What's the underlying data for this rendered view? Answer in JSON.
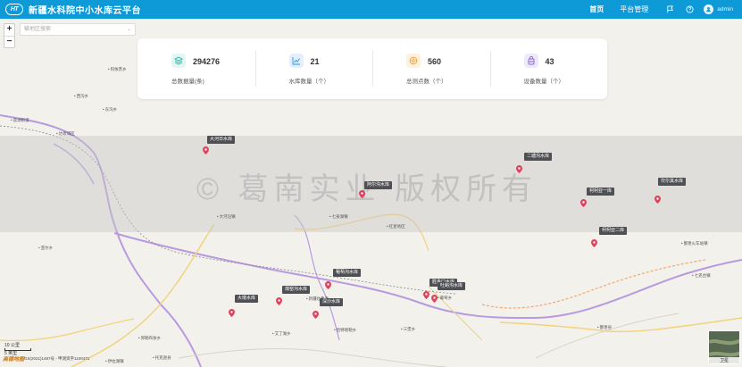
{
  "header": {
    "logo_text": "HT",
    "title": "新疆水科院中小水库云平台",
    "nav": [
      {
        "label": "首页",
        "active": true
      },
      {
        "label": "平台管理",
        "active": false
      }
    ],
    "user_name": "admin"
  },
  "map": {
    "search_placeholder": "输地区搜索",
    "zoom_in": "+",
    "zoom_out": "−",
    "watermark": "© 葛南实业 版权所有",
    "scale_label": "10 公里",
    "scale_sub": "5 英里",
    "copyright": "GS(2021)1487号 - 甲测资字1100471",
    "map_logo": "高德地图",
    "satellite_label": "卫星"
  },
  "stats": [
    {
      "icon": "layers-icon",
      "value": "294276",
      "label": "总数据量(条)",
      "color": "#2bb3a6",
      "bg": "#e2f6f3"
    },
    {
      "icon": "chart-icon",
      "value": "21",
      "label": "水库数量（个）",
      "color": "#2f8fe0",
      "bg": "#e3f0fc"
    },
    {
      "icon": "gauge-icon",
      "value": "560",
      "label": "总测点数（个）",
      "color": "#f0a43a",
      "bg": "#fdf0dd"
    },
    {
      "icon": "device-icon",
      "value": "43",
      "label": "设备数量（个）",
      "color": "#8a63d2",
      "bg": "#efe8fb"
    }
  ],
  "reservoirs": [
    {
      "name": "大河日水库"
    },
    {
      "name": "阿尔沟水库"
    },
    {
      "name": "二塘沟水库"
    },
    {
      "name": "柯柯亚一库"
    },
    {
      "name": "坎尔其水库"
    },
    {
      "name": "柯柯亚二库"
    },
    {
      "name": "葡萄沟水库"
    },
    {
      "name": "煤窑沟水库"
    },
    {
      "name": "大墩水库"
    },
    {
      "name": "深沙水库"
    },
    {
      "name": "胜金口水库"
    },
    {
      "name": "吐峪沟水库"
    }
  ],
  "places": [
    {
      "name": "阿依苏乡"
    },
    {
      "name": "西沟乡"
    },
    {
      "name": "东沟乡"
    },
    {
      "name": "达坂城区"
    },
    {
      "name": "盐湖街道"
    },
    {
      "name": "大河沿镇"
    },
    {
      "name": "七泉湖镇"
    },
    {
      "name": "红星地区"
    },
    {
      "name": "托克逊县"
    },
    {
      "name": "亚尔乡"
    },
    {
      "name": "艾丁湖乡"
    },
    {
      "name": "恰特喀勒乡"
    },
    {
      "name": "鄯善县"
    },
    {
      "name": "七克台镇"
    },
    {
      "name": "鄯善火车站镇"
    },
    {
      "name": "郭勒布依乡"
    },
    {
      "name": "伊拉湖镇"
    },
    {
      "name": "新疆吐鲁番"
    },
    {
      "name": "三堡乡"
    },
    {
      "name": "葡萄乡"
    }
  ]
}
